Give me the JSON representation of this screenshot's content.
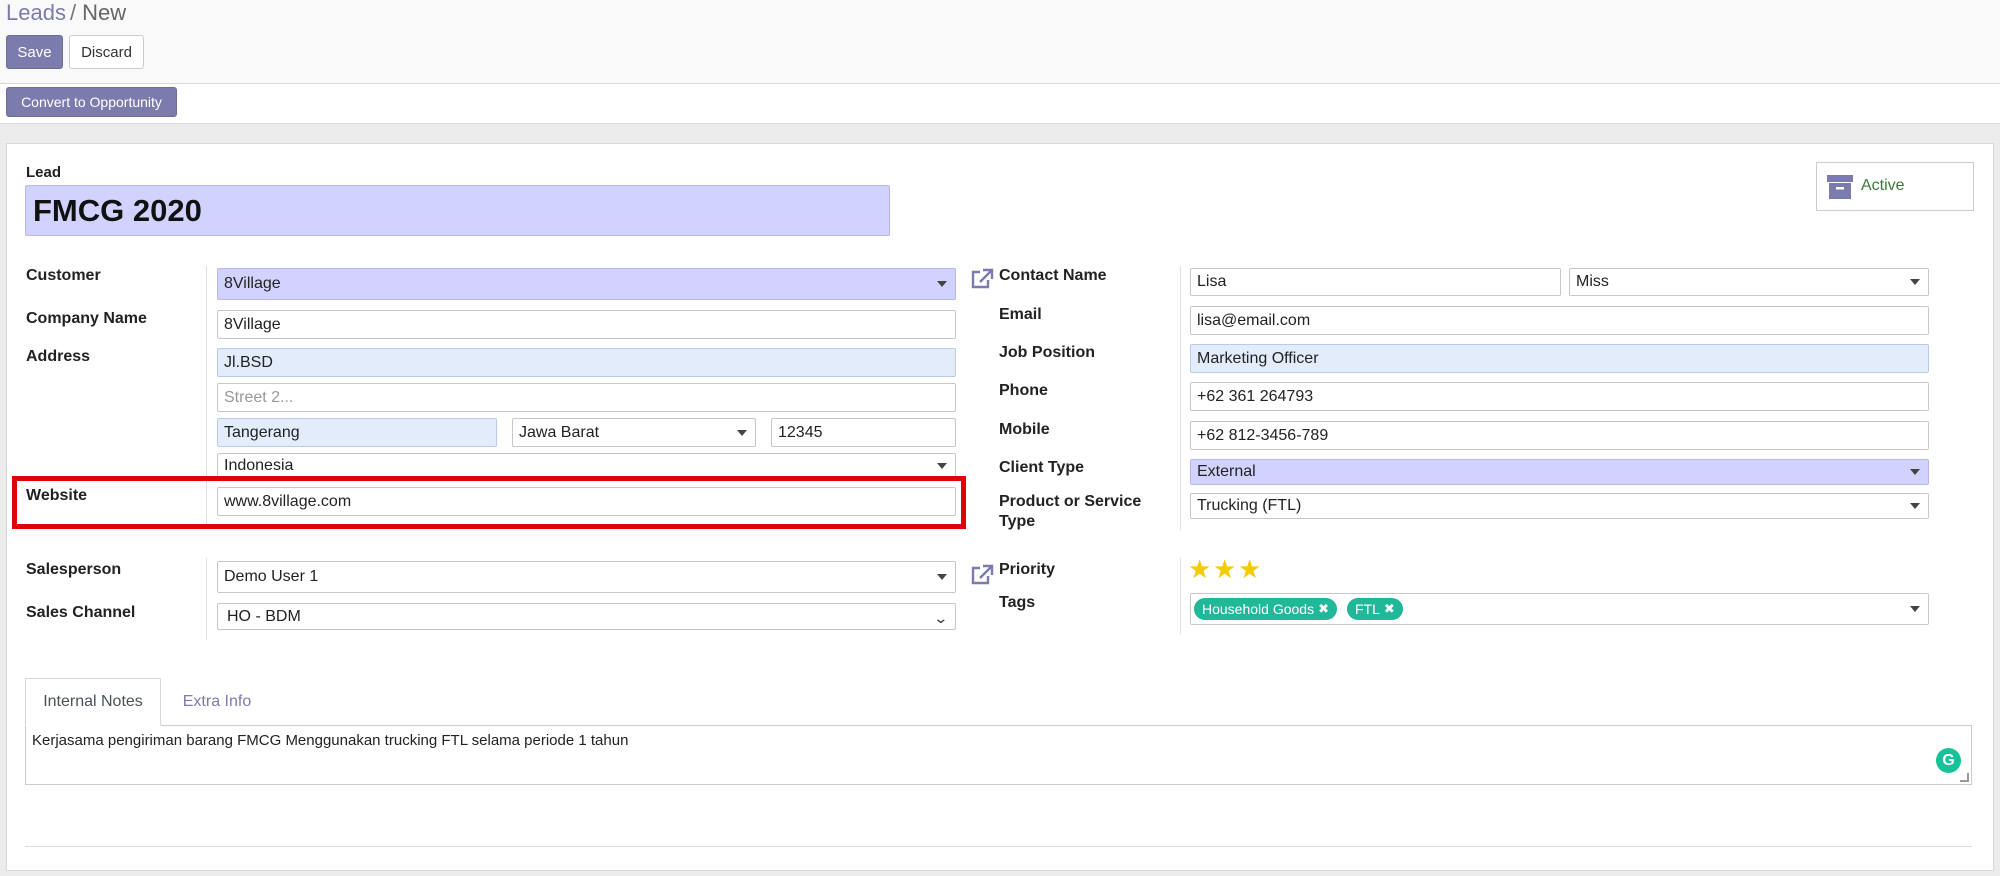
{
  "breadcrumb": {
    "parent": "Leads",
    "separator": "/",
    "current": "New"
  },
  "toolbar": {
    "save_label": "Save",
    "discard_label": "Discard",
    "convert_label": "Convert to Opportunity"
  },
  "status_button": {
    "label": "Active",
    "icon": "archive-icon"
  },
  "lead": {
    "section_label": "Lead",
    "name": "FMCG 2020"
  },
  "left": {
    "customer_label": "Customer",
    "customer_value": "8Village",
    "company_label": "Company Name",
    "company_value": "8Village",
    "address_label": "Address",
    "street": "Jl.BSD",
    "street2_placeholder": "Street 2...",
    "city": "Tangerang",
    "state": "Jawa Barat",
    "zip": "12345",
    "country": "Indonesia",
    "website_label": "Website",
    "website_value": "www.8village.com",
    "salesperson_label": "Salesperson",
    "salesperson_value": "Demo User 1",
    "channel_label": "Sales Channel",
    "channel_value": "HO - BDM"
  },
  "right": {
    "contact_label": "Contact Name",
    "contact_value": "Lisa",
    "title_value": "Miss",
    "email_label": "Email",
    "email_value": "lisa@email.com",
    "job_label": "Job Position",
    "job_value": "Marketing Officer",
    "phone_label": "Phone",
    "phone_value": "+62 361 264793",
    "mobile_label": "Mobile",
    "mobile_value": "+62 812-3456-789",
    "client_type_label": "Client Type",
    "client_type_value": "External",
    "product_label_line1": "Product or Service",
    "product_label_line2": "Type",
    "product_value": "Trucking (FTL)",
    "priority_label": "Priority",
    "priority_stars": 3,
    "priority_max": 3,
    "tags_label": "Tags",
    "tags": [
      "Household Goods",
      "FTL"
    ]
  },
  "tabs": {
    "internal_notes": "Internal Notes",
    "extra_info": "Extra Info"
  },
  "notes_text": "Kerjasama pengiriman barang FMCG Menggunakan trucking FTL selama periode 1 tahun",
  "colors": {
    "primary": "#7c7bad",
    "required_field": "#d2d2ff",
    "tag": "#21b799",
    "star": "#f3cc00",
    "highlight": "#e0000a",
    "grammarly": "#15c39a"
  }
}
